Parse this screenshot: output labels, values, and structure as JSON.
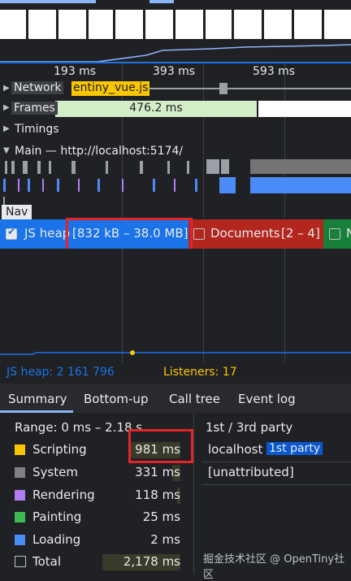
{
  "ruler": {
    "ticks": [
      "193 ms",
      "393 ms",
      "593 ms"
    ]
  },
  "tracks": {
    "network": {
      "label": "Network",
      "item": "entiny_vue.js..."
    },
    "frames": {
      "label": "Frames",
      "value": "476.2 ms"
    },
    "timings": {
      "label": "Timings"
    },
    "main": {
      "label": "Main — http://localhost:5174/"
    },
    "nav": {
      "label": "Nav"
    }
  },
  "counters": {
    "js_heap": {
      "label": "JS heap",
      "range": "[832 kB – 38.0 MB]",
      "checked": true
    },
    "documents": {
      "label": "Documents",
      "range": "[2 – 4]",
      "checked": false
    },
    "nodes": {
      "label": "N"
    }
  },
  "memory_stats": {
    "js_heap": "JS heap: 2 161 796",
    "listeners": "Listeners: 17"
  },
  "tabs": [
    "Summary",
    "Bottom-up",
    "Call tree",
    "Event log"
  ],
  "summary": {
    "range": "Range: 0 ms – 2.18 s",
    "rows": [
      {
        "label": "Scripting",
        "value": "981 ms",
        "color": "#f9c600"
      },
      {
        "label": "System",
        "value": "331 ms",
        "color": "#808080"
      },
      {
        "label": "Rendering",
        "value": "118 ms",
        "color": "#b47cf4"
      },
      {
        "label": "Painting",
        "value": "25 ms",
        "color": "#3cba54"
      },
      {
        "label": "Loading",
        "value": "2 ms",
        "color": "#4a8cf7"
      },
      {
        "label": "Total",
        "value": "2,178 ms",
        "color": "#202124"
      }
    ]
  },
  "third_party": {
    "header": "1st / 3rd party",
    "rows": [
      {
        "name": "localhost",
        "badge": "1st party"
      },
      {
        "name": "[unattributed]",
        "badge": ""
      }
    ]
  },
  "watermark": "掘金技术社区 @ OpenTiny社区",
  "colors": {
    "accent_blue": "#1a73e8",
    "documents_red": "#b3261e",
    "nodes_green": "#188038",
    "highlight_red": "#e3242b"
  }
}
